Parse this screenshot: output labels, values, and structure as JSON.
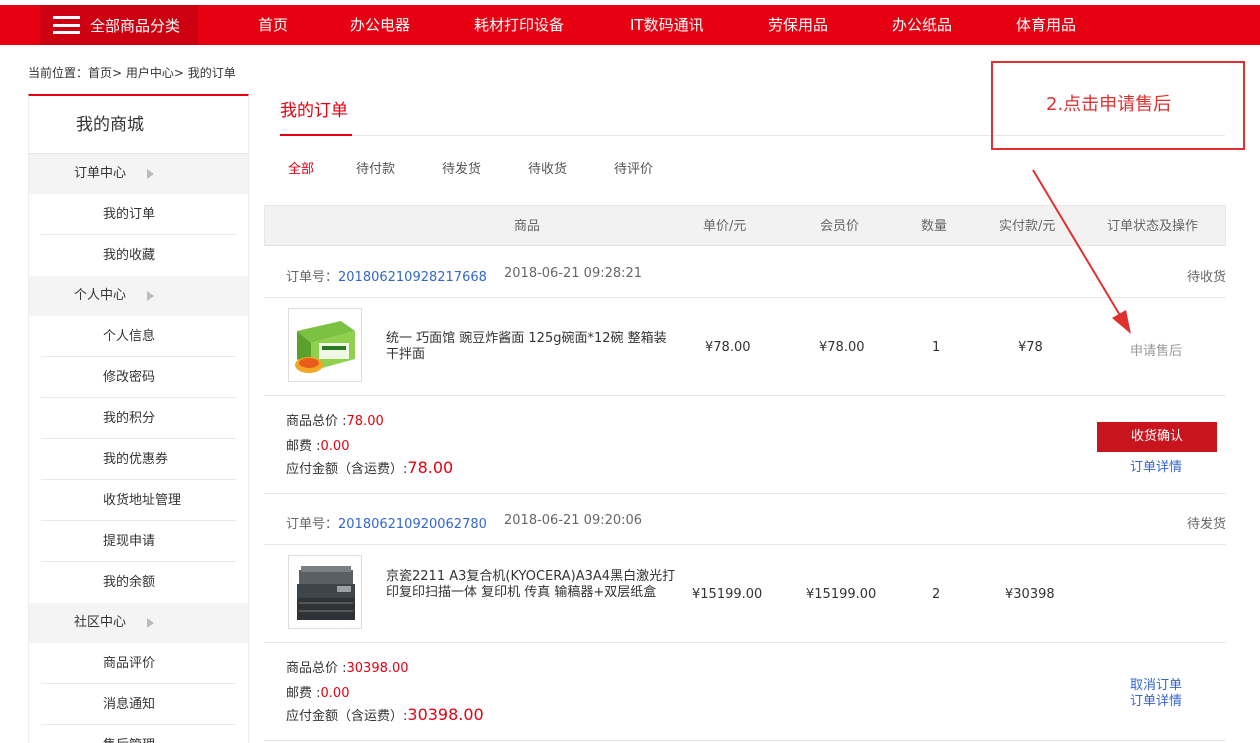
{
  "nav": {
    "category_label": "全部商品分类",
    "items": [
      "首页",
      "办公电器",
      "耗材打印设备",
      "IT数码通讯",
      "劳保用品",
      "办公纸品",
      "体育用品"
    ]
  },
  "breadcrumb": "当前位置：首页> 用户中心> 我的订单",
  "sidebar": {
    "title": "我的商城",
    "groups": [
      {
        "label": "订单中心",
        "items": [
          "我的订单",
          "我的收藏"
        ]
      },
      {
        "label": "个人中心",
        "items": [
          "个人信息",
          "修改密码",
          "我的积分",
          "我的优惠券",
          "收货地址管理",
          "提现申请",
          "我的余额"
        ]
      },
      {
        "label": "社区中心",
        "items": [
          "商品评价",
          "消息通知",
          "售后管理"
        ]
      }
    ]
  },
  "main": {
    "title": "我的订单",
    "tabs": [
      "全部",
      "待付款",
      "待发货",
      "待收货",
      "待评价"
    ],
    "columns": [
      "商品",
      "单价/元",
      "会员价",
      "数量",
      "实付款/元",
      "订单状态及操作"
    ]
  },
  "orders": [
    {
      "order_label": "订单号：",
      "order_no": "201806210928217668",
      "time": "2018-06-21 09:28:21",
      "status": "待收货",
      "product": "统一 巧面馆 豌豆炸酱面 125g碗面*12碗 整箱装 干拌面",
      "price": "¥78.00",
      "member_price": "¥78.00",
      "qty": "1",
      "paid": "¥78",
      "row_action": "申请售后",
      "total_label": "商品总价 :",
      "total": "78.00",
      "shipping_label": "邮费 :",
      "shipping": "0.00",
      "payable_label": "应付金额（含运费）:",
      "payable": "78.00",
      "actions": [
        "收货确认",
        "订单详情"
      ]
    },
    {
      "order_label": "订单号：",
      "order_no": "201806210920062780",
      "time": "2018-06-21 09:20:06",
      "status": "待发货",
      "product": "京瓷2211 A3复合机(KYOCERA)A3A4黑白激光打印复印扫描一体 复印机 传真 输稿器+双层纸盒",
      "price": "¥15199.00",
      "member_price": "¥15199.00",
      "qty": "2",
      "paid": "¥30398",
      "total_label": "商品总价 :",
      "total": "30398.00",
      "shipping_label": "邮费 :",
      "shipping": "0.00",
      "payable_label": "应付金额（含运费）:",
      "payable": "30398.00",
      "actions": [
        "取消订单",
        "订单详情"
      ]
    }
  ],
  "annotation": "2.点击申请售后",
  "colors": {
    "brand_red": "#e60012",
    "link_blue": "#3366cc",
    "annotation_red": "#e03030"
  }
}
